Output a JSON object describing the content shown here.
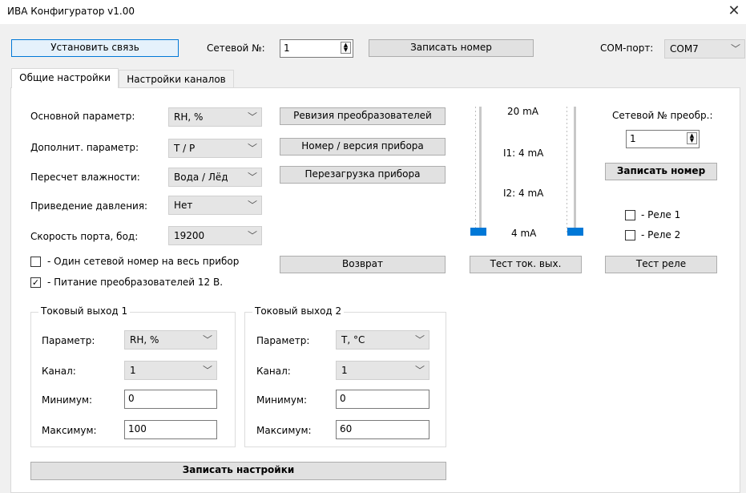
{
  "window": {
    "title": "ИВА Конфигуратор v1.00"
  },
  "icons": {
    "close": "close-icon",
    "chevron": "chevron-down-icon",
    "check": "check-icon"
  },
  "top": {
    "connect_button": "Установить связь",
    "network_label": "Сетевой №:",
    "network_value": "1",
    "write_number_button": "Записать номер",
    "com_label": "COM-порт:",
    "com_value": "COM7"
  },
  "tabs": [
    {
      "label": "Общие настройки",
      "active": true
    },
    {
      "label": "Настройки каналов",
      "active": false
    }
  ],
  "settings": {
    "main_param": {
      "label": "Основной параметр:",
      "value": "RH, %"
    },
    "extra_param": {
      "label": "Дополнит. параметр:",
      "value": "T / P"
    },
    "humidity": {
      "label": "Пересчет влажности:",
      "value": "Вода / Лёд"
    },
    "pressure": {
      "label": "Приведение давления:",
      "value": "Нет"
    },
    "baud": {
      "label": "Скорость порта, бод:",
      "value": "19200"
    }
  },
  "mid_buttons": {
    "revision": "Ревизия преобразователей",
    "version": "Номер / версия прибора",
    "reboot": "Перезагрузка прибора",
    "back": "Возврат"
  },
  "checkboxes": {
    "one_number": {
      "label": "- Один сетевой номер на весь прибор",
      "checked": false
    },
    "power12": {
      "label": "- Питание преобразователей 12 В.",
      "checked": true
    }
  },
  "current": {
    "top_label": "20 mA",
    "i1_label": "I1: 4 mA",
    "i2_label": "I2: 4 mA",
    "bottom_label": "4 mA",
    "test_button": "Тест ток. вых.",
    "slider1_level": 0,
    "slider2_level": 0
  },
  "converter": {
    "label": "Сетевой № преобр.:",
    "value": "1",
    "write_button": "Записать номер",
    "relay1": {
      "label": "- Реле 1",
      "checked": false
    },
    "relay2": {
      "label": "- Реле 2",
      "checked": false
    },
    "test_relay_button": "Тест реле"
  },
  "out1": {
    "title": "Токовый выход 1",
    "param_label": "Параметр:",
    "param_value": "RH, %",
    "channel_label": "Канал:",
    "channel_value": "1",
    "min_label": "Минимум:",
    "min_value": "0",
    "max_label": "Максимум:",
    "max_value": "100"
  },
  "out2": {
    "title": "Токовый выход 2",
    "param_label": "Параметр:",
    "param_value": "T, °C",
    "channel_label": "Канал:",
    "channel_value": "1",
    "min_label": "Минимум:",
    "min_value": "0",
    "max_label": "Максимум:",
    "max_value": "60"
  },
  "save_settings_button": "Записать настройки"
}
